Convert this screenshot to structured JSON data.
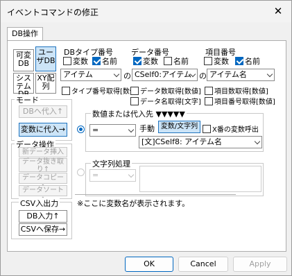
{
  "window": {
    "title": "イベントコマンドの修正",
    "close_glyph": "✕"
  },
  "tab": {
    "label": "DB操作"
  },
  "left": {
    "db_buttons": [
      "可変DB",
      "ユーザDB",
      "システムDB",
      "XY配列"
    ],
    "mode_label": "モード",
    "mode_buttons": [
      "DBへ代入↑",
      "変数に代入→"
    ],
    "ops_label": "データ操作",
    "ops_buttons": [
      "新データ挿入",
      "データ抜き取り↑",
      "データコピー↑",
      "データソート↑"
    ],
    "csv_label": "CSV入出力",
    "csv_buttons": [
      "DB入力↑",
      "CSVへ保存→"
    ]
  },
  "db_type": {
    "label": "DBタイプ番号",
    "var_label": "変数",
    "var_checked": false,
    "name_label": "名前",
    "name_checked": true,
    "select_value": "アイテム",
    "no": "の",
    "get_label": "タイプ番号取得[数値]",
    "get_checked": false
  },
  "data_num": {
    "label": "データ番号",
    "var_label": "変数",
    "var_checked": true,
    "name_label": "名前",
    "name_checked": false,
    "select_value": "CSelf0:アイテム",
    "no": "の",
    "get_count_label": "データ数取得[数値]",
    "get_count_checked": false,
    "get_name_label": "データ名取得[文字]",
    "get_name_checked": false
  },
  "item_num": {
    "label": "項目番号",
    "var_label": "変数",
    "var_checked": false,
    "name_label": "名前",
    "name_checked": true,
    "select_value": "アイテム名",
    "get_count_label": "項目数取得[数値]",
    "get_count_checked": false,
    "get_num_label": "項目番号取得[数値]",
    "get_num_checked": false
  },
  "target": {
    "label": "数値または代入先 ▼▼▼▼▼",
    "op_value": "=",
    "manual_label": "手動",
    "var_text_button": "変数/文字列",
    "xvar_label": "X番の変数呼出",
    "xvar_checked": false,
    "source_value": "[文]CSelf8: アイテム名"
  },
  "string_proc": {
    "label": "文字列処理",
    "op_value": "="
  },
  "note": "※ここに変数名が表示されます。",
  "footer": {
    "ok": "OK",
    "cancel": "Cancel",
    "apply": "Apply"
  }
}
